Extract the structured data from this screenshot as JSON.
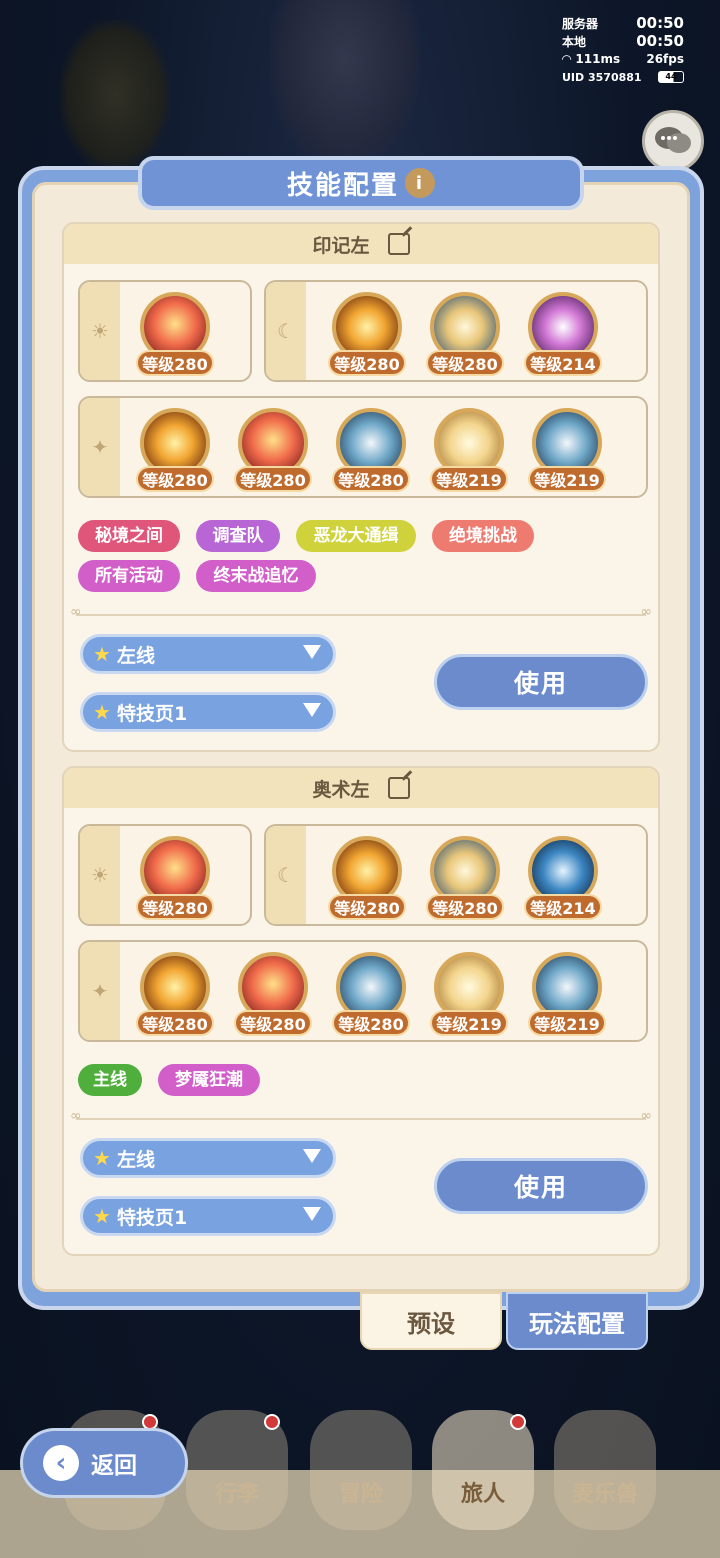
{
  "status": {
    "server_label": "服务器",
    "server_time": "00:50",
    "local_label": "本地",
    "local_time": "00:50",
    "ping": "111ms",
    "fps": "26fps",
    "uid": "UID 3570881",
    "battery": "44"
  },
  "title": "技能配置",
  "configs": [
    {
      "name": "印记左",
      "sun_skills": [
        {
          "level": "等级280",
          "icon": "fire-flower-icon"
        }
      ],
      "moon_skills": [
        {
          "level": "等级280",
          "icon": "sun-flame-icon"
        },
        {
          "level": "等级280",
          "icon": "cloud-swirl-icon"
        },
        {
          "level": "等级214",
          "icon": "target-icon"
        }
      ],
      "star_skills": [
        {
          "level": "等级280",
          "icon": "sun-burst-icon"
        },
        {
          "level": "等级280",
          "icon": "sun-flare-icon"
        },
        {
          "level": "等级280",
          "icon": "wave-icon"
        },
        {
          "level": "等级219",
          "icon": "swirl-icon"
        },
        {
          "level": "等级219",
          "icon": "wave-swirl-icon"
        }
      ],
      "tags": [
        {
          "label": "秘境之间",
          "color": "#e0557a"
        },
        {
          "label": "调查队",
          "color": "#b865d6"
        },
        {
          "label": "恶龙大通缉",
          "color": "#cfd23a"
        },
        {
          "label": "绝境挑战",
          "color": "#ee7b6f"
        },
        {
          "label": "所有活动",
          "color": "#d25fc9"
        },
        {
          "label": "终末战追忆",
          "color": "#d25fc9"
        }
      ],
      "route": "左线",
      "page": "特技页1",
      "use_label": "使用"
    },
    {
      "name": "奥术左",
      "sun_skills": [
        {
          "level": "等级280",
          "icon": "fire-flower-icon"
        }
      ],
      "moon_skills": [
        {
          "level": "等级280",
          "icon": "sun-flame-icon"
        },
        {
          "level": "等级280",
          "icon": "cloud-swirl-icon"
        },
        {
          "level": "等级214",
          "icon": "ice-spikes-icon"
        }
      ],
      "star_skills": [
        {
          "level": "等级280",
          "icon": "sun-burst-icon"
        },
        {
          "level": "等级280",
          "icon": "sun-flare-icon"
        },
        {
          "level": "等级280",
          "icon": "wave-icon"
        },
        {
          "level": "等级219",
          "icon": "swirl-icon"
        },
        {
          "level": "等级219",
          "icon": "wave-swirl-icon"
        }
      ],
      "tags": [
        {
          "label": "主线",
          "color": "#4fae3c"
        },
        {
          "label": "梦魇狂潮",
          "color": "#d25fc9"
        }
      ],
      "route": "左线",
      "page": "特技页1",
      "use_label": "使用"
    }
  ],
  "tabs": {
    "preset": "预设",
    "play_config": "玩法配置"
  },
  "nav": {
    "bag": "行李",
    "adventure": "冒险",
    "traveler": "旅人",
    "pet": "麦乐兽",
    "back": "返回"
  }
}
